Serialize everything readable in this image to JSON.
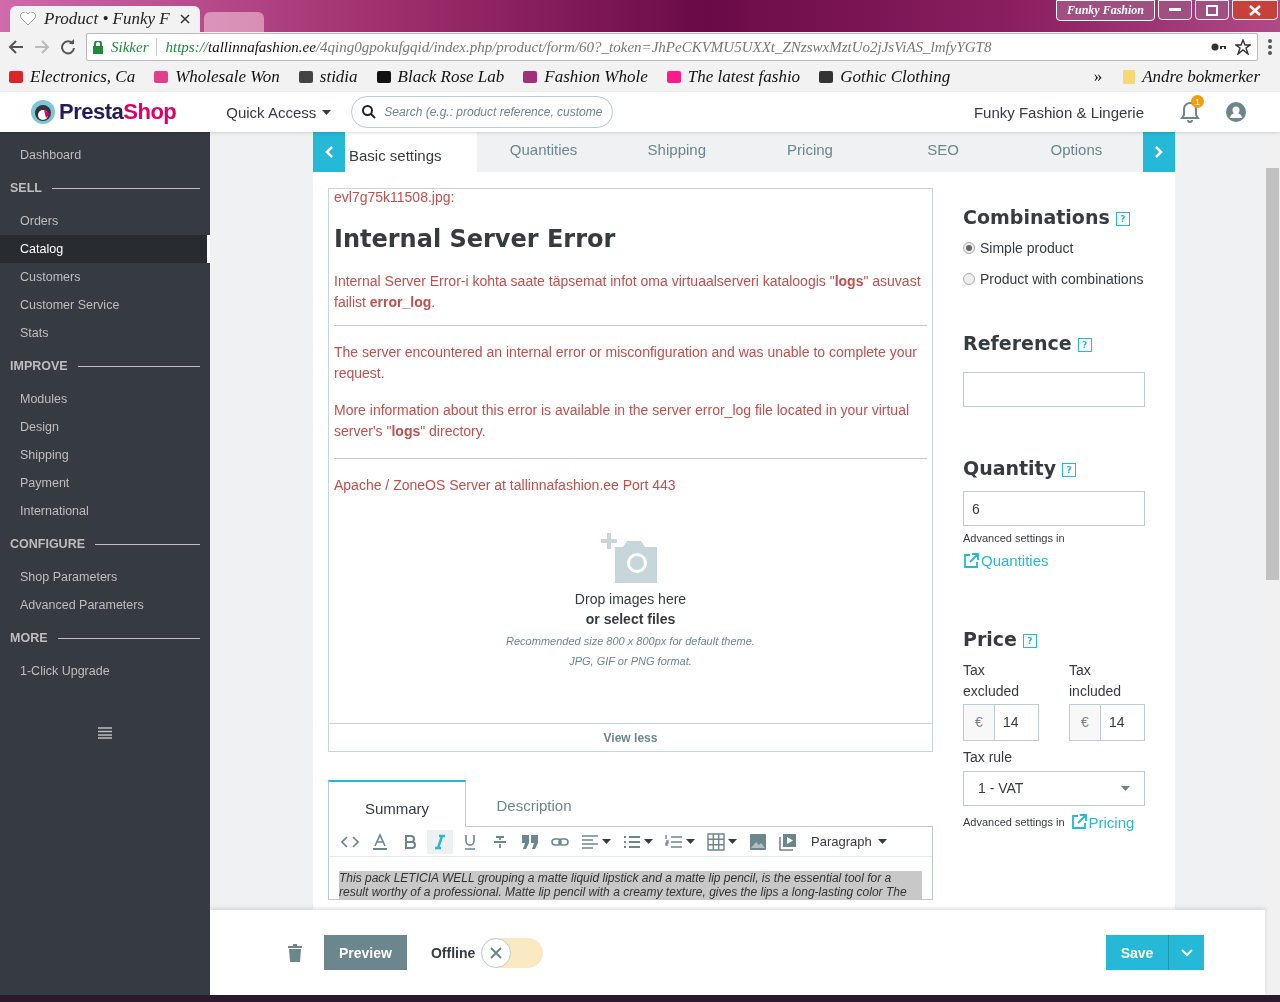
{
  "browser": {
    "tabs": [
      {
        "title": "Product • Funky F",
        "selected": true
      },
      {
        "selected": false
      }
    ],
    "window_badge": "Funky Fashion",
    "address": {
      "secure_label": "Sikker",
      "scheme": "https://",
      "host": "tallinnafashion.ee",
      "path": "/4qing0gpokufgqid/index.php/product/form/60?_token=JhPeCKVMU5UXXt_ZNzswxMztUo2jJsViAS_lmfyYGT8"
    },
    "bookmarks": [
      {
        "label": "Electronics, Ca",
        "color": "#d8262c"
      },
      {
        "label": "Wholesale Won",
        "color": "#e0408a"
      },
      {
        "label": "stidia",
        "color": "#444444"
      },
      {
        "label": "Black Rose Lab",
        "color": "#111111"
      },
      {
        "label": "Fashion Whole",
        "color": "#a0307a"
      },
      {
        "label": "The latest fashio",
        "color": "#ff1a8c"
      },
      {
        "label": "Gothic Clothing",
        "color": "#333333"
      }
    ],
    "overflow": "»",
    "other_bookmarks": "Andre bokmerker"
  },
  "header": {
    "brand_first": "Presta",
    "brand_second": "Shop",
    "quick_access": "Quick Access",
    "search_placeholder": "Search (e.g.: product reference, custome",
    "shop_name": "Funky Fashion & Lingerie",
    "notifications": "1"
  },
  "sidebar": {
    "items": [
      {
        "kind": "link",
        "label": "Dashboard",
        "selected": false
      },
      {
        "kind": "section",
        "label": "SELL"
      },
      {
        "kind": "link",
        "label": "Orders",
        "selected": false
      },
      {
        "kind": "link",
        "label": "Catalog",
        "selected": true
      },
      {
        "kind": "link",
        "label": "Customers",
        "selected": false
      },
      {
        "kind": "link",
        "label": "Customer Service",
        "selected": false
      },
      {
        "kind": "link",
        "label": "Stats",
        "selected": false
      },
      {
        "kind": "section",
        "label": "IMPROVE"
      },
      {
        "kind": "link",
        "label": "Modules",
        "selected": false
      },
      {
        "kind": "link",
        "label": "Design",
        "selected": false
      },
      {
        "kind": "link",
        "label": "Shipping",
        "selected": false
      },
      {
        "kind": "link",
        "label": "Payment",
        "selected": false
      },
      {
        "kind": "link",
        "label": "International",
        "selected": false
      },
      {
        "kind": "section",
        "label": "CONFIGURE"
      },
      {
        "kind": "link",
        "label": "Shop Parameters",
        "selected": false
      },
      {
        "kind": "link",
        "label": "Advanced Parameters",
        "selected": false
      },
      {
        "kind": "section",
        "label": "MORE"
      },
      {
        "kind": "link",
        "label": "1-Click Upgrade",
        "selected": false
      }
    ]
  },
  "product_tabs": [
    {
      "label": "Basic settings",
      "selected": true
    },
    {
      "label": "Quantities",
      "selected": false
    },
    {
      "label": "Shipping",
      "selected": false
    },
    {
      "label": "Pricing",
      "selected": false
    },
    {
      "label": "SEO",
      "selected": false
    },
    {
      "label": "Options",
      "selected": false
    }
  ],
  "error_box": {
    "file": "evl7g75k11508.jpg:",
    "heading": "Internal Server Error",
    "intro": "Internal Server Error-i kohta saate täpsemat infot oma virtuaalserveri kataloogis \"**logs**\" asuvast failist **error_log**.",
    "paragraphs": [
      "The server encountered an internal error or misconfiguration and was unable to complete your request.",
      "More information about this error is available in the server error_log file located in your virtual server's \"**logs**\" directory."
    ],
    "server": "Apache / ZoneOS Server at tallinnafashion.ee Port 443"
  },
  "dropzone": {
    "title": "Drop images here",
    "link": "or select files",
    "hint_size": "Recommended size 800 x 800px for default theme.",
    "hint_format": "JPG, GIF or PNG format.",
    "view_less": "View less"
  },
  "description_tabs": [
    {
      "label": "Summary",
      "selected": true
    },
    {
      "label": "Description",
      "selected": false
    }
  ],
  "editor": {
    "toolbar": [
      {
        "kind": "code",
        "active": false
      },
      {
        "kind": "color",
        "active": false
      },
      {
        "kind": "bold",
        "active": false
      },
      {
        "kind": "italic",
        "active": true
      },
      {
        "kind": "underline",
        "active": false
      },
      {
        "kind": "strike",
        "active": false
      },
      {
        "kind": "quote",
        "active": false
      },
      {
        "kind": "link",
        "active": false
      },
      {
        "kind": "align",
        "active": false
      },
      {
        "kind": "bullets",
        "active": false
      },
      {
        "kind": "numbers",
        "active": false
      },
      {
        "kind": "table",
        "active": false
      },
      {
        "kind": "image",
        "active": false
      },
      {
        "kind": "media",
        "active": false
      }
    ],
    "format": "Paragraph",
    "content": "This pack LETICIA WELL grouping a matte liquid lipstick and a matte lip pencil, is the essential tool for a result worthy of a professional. Matte lip pencil with a creamy texture, gives the lips a long-lasting color The"
  },
  "combinations": {
    "title": "Combinations",
    "help": "?",
    "options": [
      {
        "label": "Simple product",
        "selected": true
      },
      {
        "label": "Product with combinations",
        "selected": false
      }
    ]
  },
  "reference": {
    "title": "Reference",
    "help": "?"
  },
  "quantity": {
    "title": "Quantity",
    "help": "?",
    "value": "6",
    "note": "Advanced settings in",
    "link": "Quantities"
  },
  "price": {
    "title": "Price",
    "help": "?",
    "tax_excluded": {
      "label": "Tax excluded",
      "currency": "€",
      "value": "14"
    },
    "tax_included": {
      "label": "Tax included",
      "currency": "€",
      "value": "14"
    },
    "tax_rule_label": "Tax rule",
    "tax_rule": "1 - VAT",
    "note": "Advanced settings in",
    "link": "Pricing"
  },
  "footer": {
    "preview": "Preview",
    "offline_label": "Offline",
    "online": false,
    "save": "Save"
  }
}
